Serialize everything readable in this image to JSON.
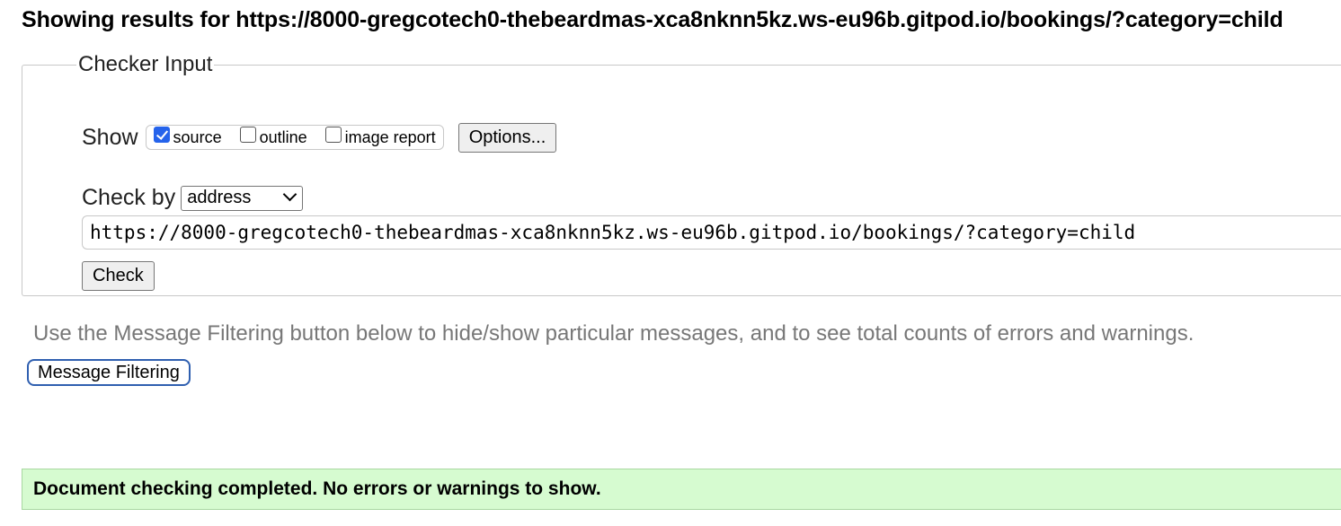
{
  "heading": "Showing results for https://8000-gregcotech0-thebeardmas-xca8nknn5kz.ws-eu96b.gitpod.io/bookings/?category=child",
  "checker": {
    "legend": "Checker Input",
    "show_label": "Show",
    "show_options": [
      {
        "label": "source",
        "checked": true
      },
      {
        "label": "outline",
        "checked": false
      },
      {
        "label": "image report",
        "checked": false
      }
    ],
    "options_button": "Options...",
    "check_by_label": "Check by",
    "check_by_value": "address",
    "url_value": "https://8000-gregcotech0-thebeardmas-xca8nknn5kz.ws-eu96b.gitpod.io/bookings/?category=child",
    "check_button": "Check"
  },
  "filter": {
    "hint": "Use the Message Filtering button below to hide/show particular messages, and to see total counts of errors and warnings.",
    "button": "Message Filtering"
  },
  "result": {
    "message": "Document checking completed. No errors or warnings to show."
  },
  "colors": {
    "success_bg": "#d6fbd0",
    "checkbox_accent": "#2563eb",
    "filter_border": "#2f5fb0",
    "hint_text": "#777777"
  }
}
